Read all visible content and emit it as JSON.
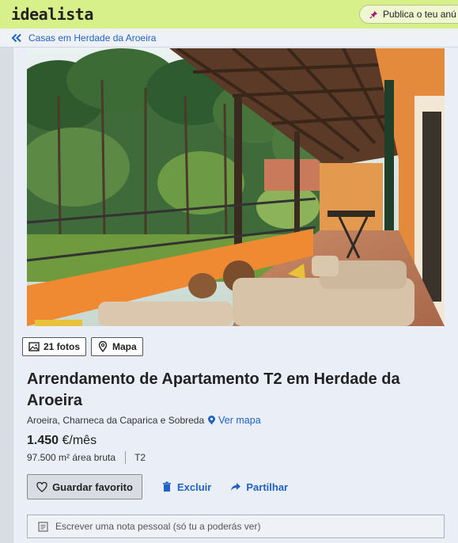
{
  "header": {
    "logo": "idealista",
    "publish_label": "Publica o teu anú"
  },
  "breadcrumb": {
    "label": "Casas em Herdade da Aroeira"
  },
  "media": {
    "photos_label": "21 fotos",
    "map_label": "Mapa"
  },
  "listing": {
    "title": "Arrendamento de Apartamento T2 em Herdade da Aroeira",
    "location": "Aroeira, Charneca da Caparica e Sobreda",
    "see_map": "Ver mapa",
    "price_value": "1.450",
    "price_unit": "€/mês",
    "area": "97.500 m² área bruta",
    "typology": "T2"
  },
  "actions": {
    "favorite": "Guardar favorito",
    "delete": "Excluir",
    "share": "Partilhar"
  },
  "note": {
    "placeholder": "Escrever uma nota pessoal (só tu a poderás ver)"
  },
  "colors": {
    "brand": "#d8f08a",
    "link": "#1f62c4"
  }
}
